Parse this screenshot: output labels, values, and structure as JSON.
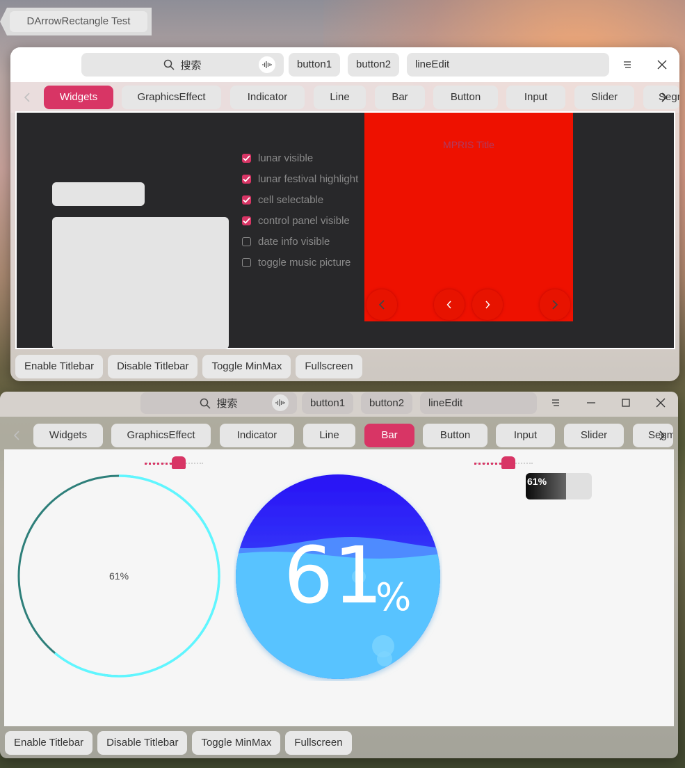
{
  "arrow_test": {
    "label": "DArrowRectangle Test"
  },
  "window1": {
    "search_placeholder": "搜索",
    "button1": "button1",
    "button2": "button2",
    "line_edit": "lineEdit",
    "tabs": [
      "Widgets",
      "GraphicsEffect",
      "Indicator",
      "Line",
      "Bar",
      "Button",
      "Input",
      "Slider",
      "Segm"
    ],
    "active_tab": "Widgets",
    "checkboxes": [
      {
        "label": "lunar visible",
        "checked": true
      },
      {
        "label": "lunar festival highlight",
        "checked": true
      },
      {
        "label": "cell selectable",
        "checked": true
      },
      {
        "label": "control panel visible",
        "checked": true
      },
      {
        "label": "date info visible",
        "checked": false
      },
      {
        "label": "toggle music picture",
        "checked": false
      }
    ],
    "mpris_title": "MPRIS Title",
    "bottom_buttons": [
      "Enable Titlebar",
      "Disable Titlebar",
      "Toggle MinMax",
      "Fullscreen"
    ]
  },
  "window2": {
    "search_placeholder": "搜索",
    "button1": "button1",
    "button2": "button2",
    "line_edit": "lineEdit",
    "tabs": [
      "Widgets",
      "GraphicsEffect",
      "Indicator",
      "Line",
      "Bar",
      "Button",
      "Input",
      "Slider",
      "Segm"
    ],
    "active_tab": "Bar",
    "ring_progress": {
      "label": "61%",
      "value": 0.61
    },
    "water_progress": {
      "number": "61",
      "unit": "%",
      "value": 0.61
    },
    "small_progress": {
      "label": "61%",
      "value": 0.61
    },
    "slider_left_value": 0.61,
    "slider_right_value": 0.61,
    "bottom_buttons": [
      "Enable Titlebar",
      "Disable Titlebar",
      "Toggle MinMax",
      "Fullscreen"
    ]
  },
  "colors": {
    "accent": "#d83565",
    "mpris_bg": "#ee1100",
    "water_top": "#2a12f5",
    "water_bottom": "#58c3ff",
    "ring_start": "#2e7f7a",
    "ring_end": "#5ff6ff"
  },
  "icons": [
    "search-icon",
    "voice-icon",
    "menu-icon",
    "close-icon",
    "minimize-icon",
    "maximize-icon",
    "chevron-left-icon",
    "chevron-right-icon",
    "check-icon"
  ]
}
